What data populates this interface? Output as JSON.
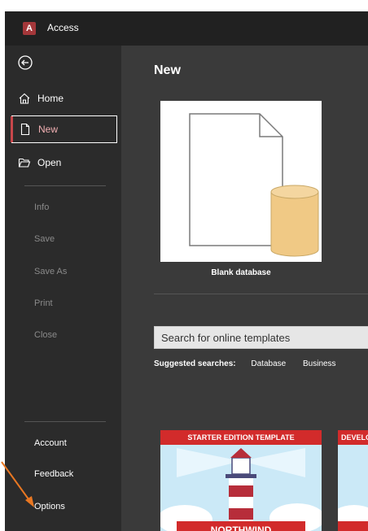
{
  "app": {
    "title": "Access",
    "logo_letter": "A"
  },
  "sidebar": {
    "nav": [
      {
        "label": "Home"
      },
      {
        "label": "New"
      },
      {
        "label": "Open"
      }
    ],
    "disabled_items": [
      "Info",
      "Save",
      "Save As",
      "Print",
      "Close"
    ],
    "bottom_items": [
      "Account",
      "Feedback",
      "Options"
    ]
  },
  "main": {
    "title": "New",
    "blank_database_label": "Blank database",
    "search_placeholder": "Search for online templates",
    "suggested_label": "Suggested searches:",
    "suggested": [
      "Database",
      "Business"
    ],
    "templates": [
      {
        "banner": "STARTER EDITION TEMPLATE",
        "name": "NORTHWIND"
      },
      {
        "banner": "DEVELOPER EDITION TEMPLATE"
      }
    ]
  },
  "colors": {
    "titlebar": "#212121",
    "sidebar": "#2b2b2b",
    "main": "#3a3a3a",
    "accent": "#c8474b",
    "annotation_arrow": "#e87722",
    "template_banner": "#d22b2b"
  }
}
